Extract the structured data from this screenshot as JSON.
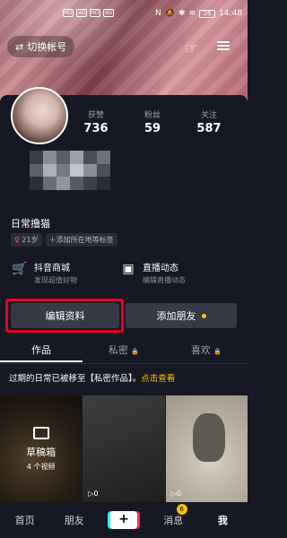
{
  "status": {
    "left_badges": [
      "HD",
      "4G",
      "HD",
      "4G"
    ],
    "battery": "26",
    "time": "14:48"
  },
  "header": {
    "switch_account_label": "切换帐号"
  },
  "stats": [
    {
      "label": "获赞",
      "value": "736"
    },
    {
      "label": "粉丝",
      "value": "59"
    },
    {
      "label": "关注",
      "value": "587"
    }
  ],
  "bio": "日常撸猫",
  "tags": {
    "age": "21岁",
    "add_location": "＋添加所在地等标签"
  },
  "shortcuts": [
    {
      "title": "抖音商城",
      "subtitle": "发现超值好物"
    },
    {
      "title": "直播动态",
      "subtitle": "编辑直播动态"
    }
  ],
  "buttons": {
    "edit": "编辑资料",
    "add_friend": "添加朋友"
  },
  "tabs": [
    {
      "label": "作品"
    },
    {
      "label": "私密"
    },
    {
      "label": "喜欢"
    }
  ],
  "notice": {
    "text": "过期的日常已被移至【私密作品】。",
    "link": "点击查看"
  },
  "grid": {
    "draft_title": "草稿箱",
    "draft_count": "4 个视频",
    "play2": "0",
    "play3": "0"
  },
  "bottom_nav": {
    "home": "首页",
    "friends": "朋友",
    "plus": "+",
    "messages": "消息",
    "messages_badge": "6",
    "me": "我"
  },
  "colors": {
    "background": "#161823",
    "highlight": "#e60023",
    "accent_yellow": "#ffc300"
  }
}
